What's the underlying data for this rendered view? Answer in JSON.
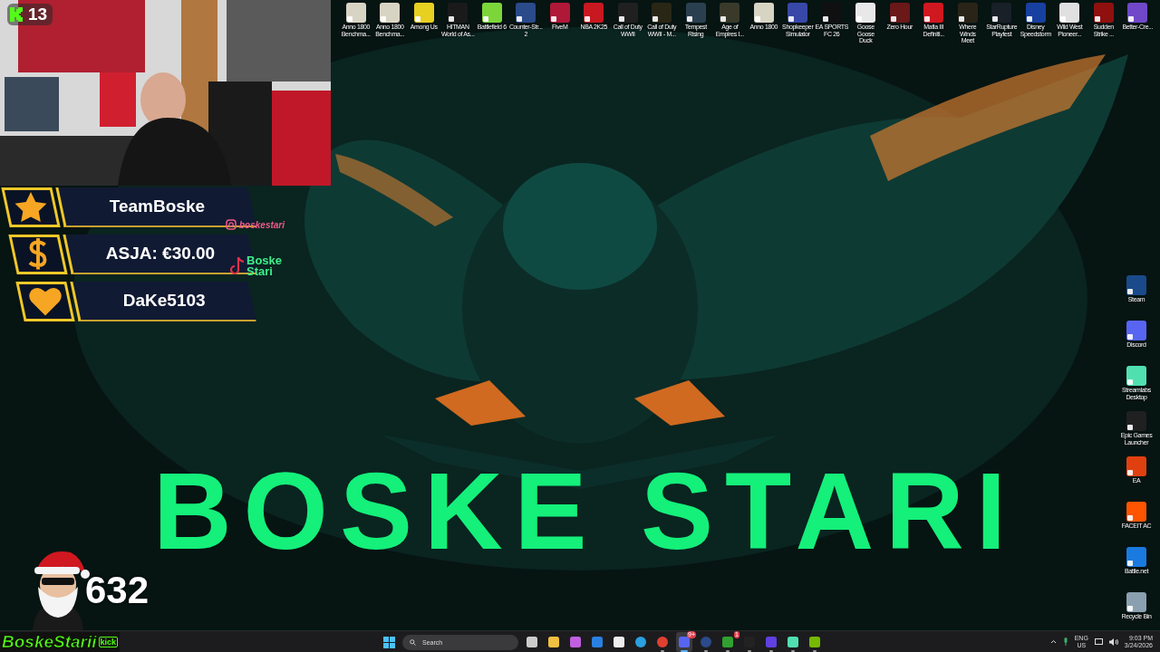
{
  "wallpaper": {
    "kind": "picture",
    "title": "BOSKE STARI"
  },
  "desktop_icons_top": [
    {
      "label": "Anno 1800\nBenchma...",
      "color": "#d8d4c4"
    },
    {
      "label": "Anno 1800\nBenchma...",
      "color": "#d8d4c4"
    },
    {
      "label": "Among Us",
      "color": "#e8d020"
    },
    {
      "label": "HITMAN\nWorld of As...",
      "color": "#1a1a1a"
    },
    {
      "label": "Battlefield 6",
      "color": "#7cd63a"
    },
    {
      "label": "Counter-Str...\n2",
      "color": "#2a4a8a"
    },
    {
      "label": "FiveM",
      "color": "#b01838"
    },
    {
      "label": "NBA 2K25",
      "color": "#c81820"
    },
    {
      "label": "Call of Duty\nWWII",
      "color": "#202020"
    },
    {
      "label": "Call of Duty\nWWII - M...",
      "color": "#2a2616"
    },
    {
      "label": "Tempest\nRising",
      "color": "#2a4050"
    },
    {
      "label": "Age of\nEmpires I...",
      "color": "#3a3a2a"
    },
    {
      "label": "Anno 1800",
      "color": "#d8d4c4"
    },
    {
      "label": "Shopkeeper\nSimulator",
      "color": "#3848a8"
    },
    {
      "label": "EA SPORTS\nFC 26",
      "color": "#101010"
    },
    {
      "label": "Goose Goose\nDuck",
      "color": "#e8e8e8"
    },
    {
      "label": "Zero Hour",
      "color": "#6a1818"
    },
    {
      "label": "Mafia III\nDefiniti...",
      "color": "#d01820"
    },
    {
      "label": "Where Winds\nMeet",
      "color": "#2a2418"
    },
    {
      "label": "StarRupture\nPlaytest",
      "color": "#182028"
    },
    {
      "label": "Disney\nSpeedstorm",
      "color": "#1840a0"
    },
    {
      "label": "Wild West\nPioneer...",
      "color": "#e0e0e0"
    },
    {
      "label": "Sudden\nStrike ...",
      "color": "#901010"
    },
    {
      "label": "Better-Cre...",
      "color": "#7048c8"
    }
  ],
  "desktop_icons_right": [
    {
      "label": "Steam",
      "color": "#1a4a8a"
    },
    {
      "label": "Discord",
      "color": "#5865f2"
    },
    {
      "label": "Streamlabs\nDesktop",
      "color": "#50e0b0"
    },
    {
      "label": "Epic Games\nLauncher",
      "color": "#202020"
    },
    {
      "label": "EA",
      "color": "#e04010"
    },
    {
      "label": "FACEIT AC",
      "color": "#ff5500"
    },
    {
      "label": "Battle.net",
      "color": "#1a7ae0"
    },
    {
      "label": "Recycle Bin",
      "color": "#8aa0b0"
    }
  ],
  "stream_overlay": {
    "viewer_count": "13",
    "alerts": [
      {
        "kind": "star",
        "text": "TeamBoske"
      },
      {
        "kind": "dollar",
        "text": "ASJA: €30.00"
      },
      {
        "kind": "heart",
        "text": "DaKe5103"
      }
    ],
    "instagram": "boskestari",
    "tiktok": "Boske\nStari",
    "counter": "632",
    "channel_name": "BoskeStarii",
    "platform": "kick"
  },
  "taskbar": {
    "search": {
      "placeholder": "Search"
    },
    "apps": [
      {
        "kind": "taskview",
        "running": false
      },
      {
        "kind": "folder",
        "running": false
      },
      {
        "kind": "copilot",
        "running": false
      },
      {
        "kind": "mail",
        "running": false
      },
      {
        "kind": "store",
        "running": false
      },
      {
        "kind": "telegram",
        "running": false
      },
      {
        "kind": "chrome",
        "running": true
      },
      {
        "kind": "discord",
        "running": true,
        "badge": "9+",
        "selected": true
      },
      {
        "kind": "steam",
        "running": true
      },
      {
        "kind": "xbox",
        "running": true,
        "badge": "1"
      },
      {
        "kind": "terminal",
        "running": true
      },
      {
        "kind": "grid",
        "running": true
      },
      {
        "kind": "streamlabs",
        "running": true
      },
      {
        "kind": "nvidia",
        "running": true
      }
    ],
    "language": "ENG\nUS",
    "time": "9:03 PM",
    "date": "3/24/2026"
  }
}
